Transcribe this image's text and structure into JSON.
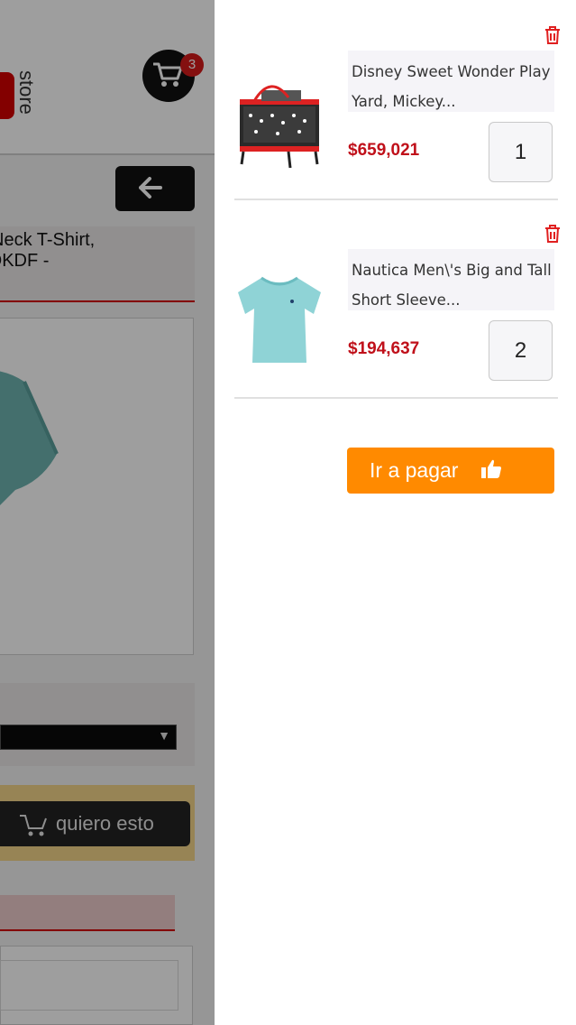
{
  "background_page": {
    "logo_text": "store",
    "cart_count": "3",
    "product_title": "w Neck T-Shirt,\nMQKDF -",
    "want_button_label": "quiero esto",
    "variant_arrow": "▼"
  },
  "cart": {
    "items": [
      {
        "name_line1": "Disney Sweet Wonder Play",
        "name_line2": "Yard, Mickey...",
        "price": "$659,021",
        "quantity": "1"
      },
      {
        "name_line1": "Nautica Men\\'s Big and Tall",
        "name_line2": "Short Sleeve...",
        "price": "$194,637",
        "quantity": "2"
      }
    ],
    "checkout_label": "Ir a pagar"
  },
  "colors": {
    "accent_orange": "#ff8a00",
    "price_red": "#c0101a",
    "trash_red": "#e02020"
  },
  "icons": {
    "cart": "shopping-cart-icon",
    "back": "arrow-left-icon",
    "delete": "trash-icon",
    "checkout": "thumbs-up-icon"
  }
}
